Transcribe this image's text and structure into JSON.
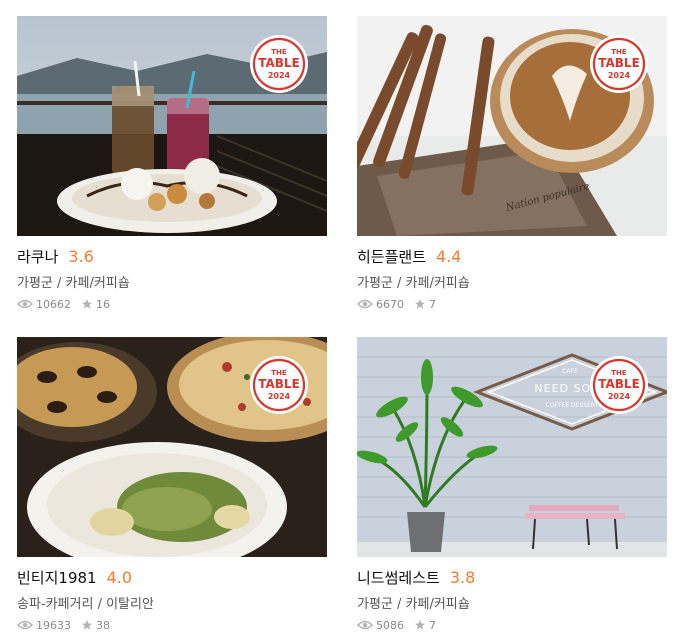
{
  "badge": {
    "line1": "THE",
    "line2": "TABLE",
    "line3": "2024",
    "color": "#d8372c"
  },
  "colors": {
    "rating": "#ff792a",
    "stat_icon": "#b4b4b4"
  },
  "cards": [
    {
      "name": "라쿠나",
      "rating": "3.6",
      "meta": "가평군 / 카페/커피숍",
      "views": "10662",
      "stars": "16"
    },
    {
      "name": "히든플랜트",
      "rating": "4.4",
      "meta": "가평군 / 카페/커피숍",
      "views": "6670",
      "stars": "7"
    },
    {
      "name": "빈티지1981",
      "rating": "4.0",
      "meta": "송파-카페거리 / 이탈리안",
      "views": "19633",
      "stars": "38"
    },
    {
      "name": "니드썸레스트",
      "rating": "3.8",
      "meta": "가평군 / 카페/커피숍",
      "views": "5086",
      "stars": "7"
    }
  ],
  "photo_signs": {
    "need_some": "NEED SOME",
    "coffee_dessert": "COFFEE DESSERT",
    "cafe": "CAFE"
  },
  "icons": {
    "views": "eye-icon",
    "stars": "star-icon"
  }
}
